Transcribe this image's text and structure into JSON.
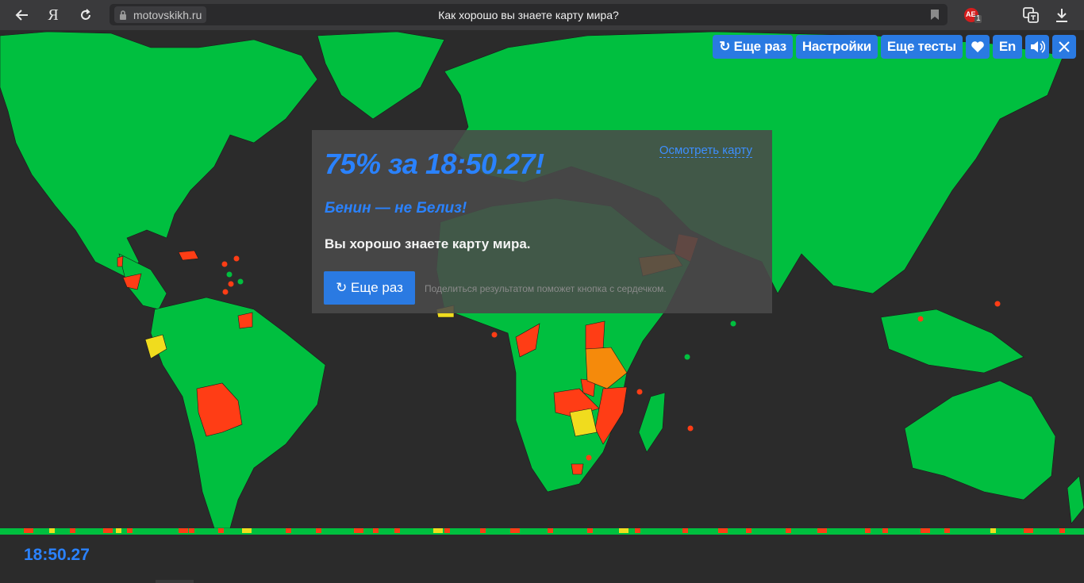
{
  "browser": {
    "domain": "motovskikh.ru",
    "title": "Как хорошо вы знаете карту мира?",
    "yandex_letter": "Я",
    "extension_badge": "1",
    "extension_label": "AE"
  },
  "toolbar": {
    "again_label": "↻ Еще раз",
    "settings_label": "Настройки",
    "more_tests_label": "Еще тесты",
    "lang_label": "En"
  },
  "result": {
    "score": "75% за 18:50.27!",
    "review_link": "Осмотреть карту",
    "mistake": "Бенин — не Белиз!",
    "verdict": "Вы хорошо знаете карту мира.",
    "again_button": "↻ Еще раз",
    "share_hint": "Поделиться результатом поможет кнопка с сердечком."
  },
  "timer": "18:50.27",
  "colors": {
    "land_correct": "#00bf3f",
    "land_wrong": "#ff3d15",
    "land_second": "#f58a0b",
    "land_third": "#f0dc1e",
    "ocean": "#2b2b2b",
    "accent": "#2a7ae2"
  },
  "icons": [
    "back-icon",
    "yandex-icon",
    "reload-icon",
    "lock-icon",
    "bookmark-icon",
    "extension-icon",
    "translate-icon",
    "download-icon",
    "heart-icon",
    "sound-icon",
    "close-icon"
  ]
}
